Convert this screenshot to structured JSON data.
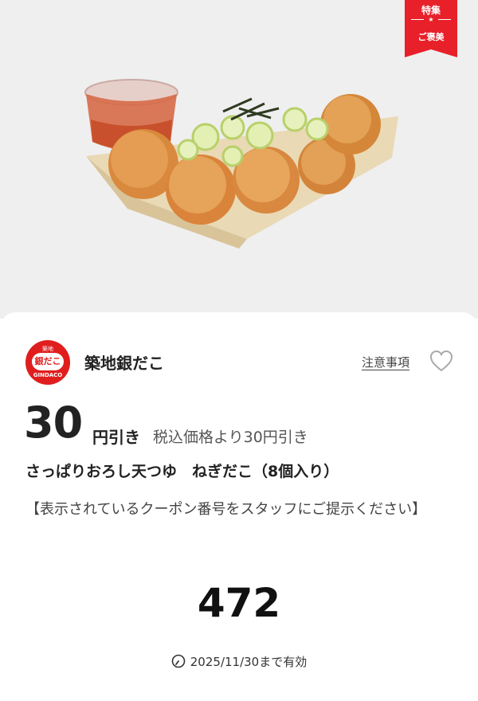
{
  "badge": {
    "line1": "特集",
    "line2": "ご褒美",
    "star": "★",
    "color": "#e8202a"
  },
  "store": {
    "name": "築地銀だこ",
    "logo_text": "銀だこ",
    "logo_sub": "GINDACO",
    "logo_top": "築地"
  },
  "notes_link": "注意事項",
  "favorite_icon": "heart-outline-icon",
  "discount": {
    "amount": "30",
    "unit": "円引き",
    "note": "税込価格より30円引き"
  },
  "product_name": "さっぱりおろし天つゆ　ねぎだこ（8個入り）",
  "instruction": "【表示されているクーポン番号をスタッフにご提示ください】",
  "coupon_code": "472",
  "expiry": {
    "icon": "clock-icon",
    "text": "2025/11/30まで有効"
  },
  "colors": {
    "accent": "#e8202a",
    "background_top": "#efefef"
  }
}
